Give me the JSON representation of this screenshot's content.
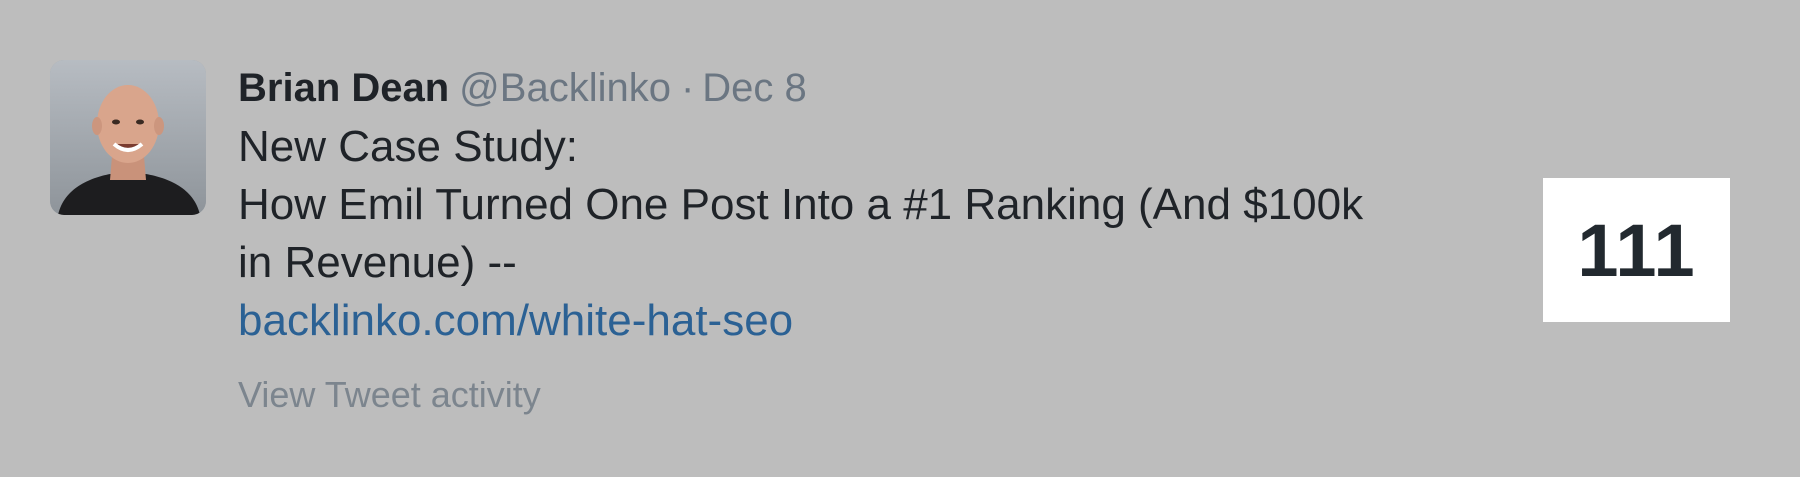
{
  "tweet": {
    "author_name": "Brian Dean",
    "handle": "@Backlinko",
    "separator": "·",
    "date": "Dec 8",
    "text_lines": [
      "New Case Study:",
      "How Emil Turned One Post Into a #1 Ranking (And $100k",
      "in Revenue)  --"
    ],
    "link_text": "backlinko.com/white-hat-seo",
    "activity_label": "View Tweet activity",
    "impressions": "111"
  },
  "colors": {
    "background": "#bdbdbd",
    "link": "#2b6194",
    "muted": "#6b7682",
    "text": "#1f2328"
  },
  "icons": {
    "avatar": "profile-photo"
  }
}
